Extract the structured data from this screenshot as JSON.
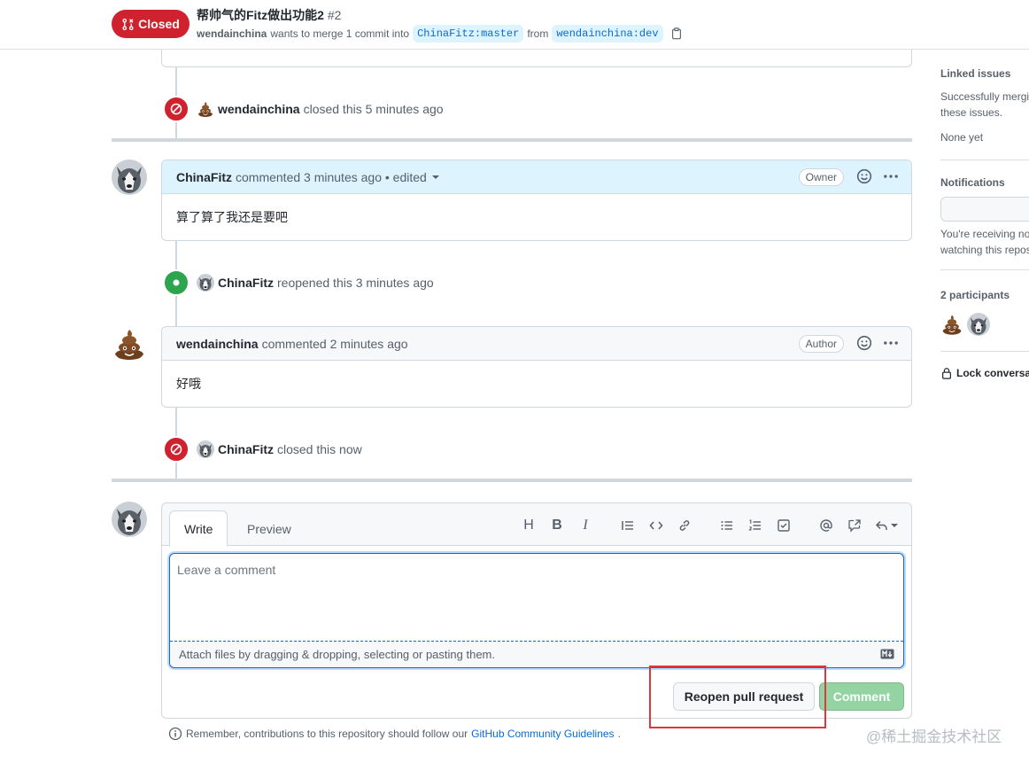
{
  "header": {
    "state_label": "Closed",
    "title": "帮帅气的Fitz做出功能2",
    "number": "#2",
    "author": "wendainchina",
    "merge_text": "wants to merge 1 commit into",
    "base_branch": "ChinaFitz:master",
    "from_text": "from",
    "head_branch": "wendainchina:dev"
  },
  "timeline": {
    "event_closed_1": {
      "who": "wendainchina",
      "text": "closed this 5 minutes ago"
    },
    "comment_1": {
      "who": "ChinaFitz",
      "meta": "commented 3 minutes ago • edited",
      "role": "Owner",
      "body": "算了算了我还是要吧"
    },
    "event_reopened": {
      "who": "ChinaFitz",
      "text": "reopened this 3 minutes ago"
    },
    "comment_2": {
      "who": "wendainchina",
      "meta": "commented 2 minutes ago",
      "role": "Author",
      "body": "好哦"
    },
    "event_closed_2": {
      "who": "ChinaFitz",
      "text": "closed this now"
    }
  },
  "form": {
    "tab_write": "Write",
    "tab_preview": "Preview",
    "placeholder": "Leave a comment",
    "attach_text": "Attach files by dragging & dropping, selecting or pasting them.",
    "reopen_label": "Reopen pull request",
    "comment_label": "Comment",
    "toolbar_heading": "H",
    "toolbar_bold": "B",
    "toolbar_italic": "I"
  },
  "footer": {
    "guidelines_prefix": "Remember, contributions to this repository should follow our",
    "guidelines_link": "GitHub Community Guidelines",
    "guidelines_suffix": "."
  },
  "watermark": "@稀土掘金技术社区",
  "sidebar": {
    "linked_title": "Linked issues",
    "linked_line1": "Successfully mergin",
    "linked_line2": "these issues.",
    "linked_none": "None yet",
    "notif_title": "Notifications",
    "notif_line1": "You're receiving no",
    "notif_line2": "watching this repos",
    "participants_title": "2 participants",
    "lock_label": "Lock conversat"
  },
  "colors": {
    "closed_red": "#cf222e",
    "open_green": "#2da44e",
    "link_blue": "#0969da",
    "comment_disabled_green": "#94d3a2",
    "highlight_red": "#e0363e"
  }
}
